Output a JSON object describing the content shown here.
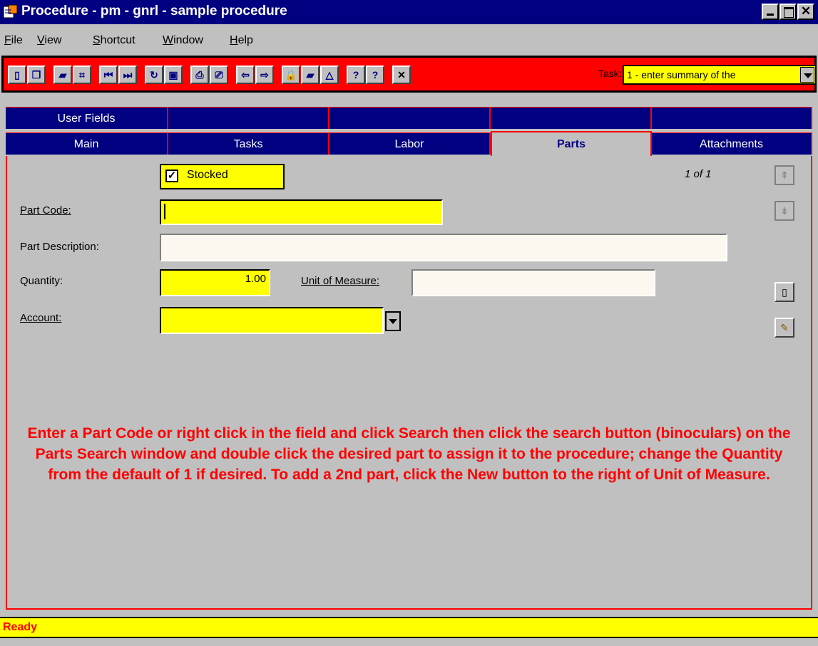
{
  "window": {
    "title": "Procedure - pm - gnrl - sample procedure",
    "minimize": "minimize",
    "maximize": "maximize",
    "close_glyph": "✕"
  },
  "menu": [
    {
      "label": "File",
      "accel": "F",
      "rest": "ile"
    },
    {
      "label": "View",
      "accel": "V",
      "rest": "iew"
    },
    {
      "label": "Shortcut",
      "accel": "S",
      "rest": "hortcut"
    },
    {
      "label": "Window",
      "accel": "W",
      "rest": "indow"
    },
    {
      "label": "Help",
      "accel": "H",
      "rest": "elp"
    }
  ],
  "toolbar": {
    "buttons": [
      {
        "name": "new-icon",
        "glyph": "▯"
      },
      {
        "name": "copy-icon",
        "glyph": "❐"
      },
      {
        "name": "open-folder-icon",
        "glyph": "▰"
      },
      {
        "name": "structure-icon",
        "glyph": "⌗"
      },
      {
        "name": "first-record-icon",
        "glyph": "⏮"
      },
      {
        "name": "last-record-icon",
        "glyph": "⏭"
      },
      {
        "name": "refresh-icon",
        "glyph": "↻"
      },
      {
        "name": "save-icon",
        "glyph": "▣"
      },
      {
        "name": "print-icon",
        "glyph": "⎙"
      },
      {
        "name": "print-preview-icon",
        "glyph": "⎚"
      },
      {
        "name": "back-icon",
        "glyph": "⇦"
      },
      {
        "name": "forward-icon",
        "glyph": "⇨"
      },
      {
        "name": "lock-icon",
        "glyph": "🔒"
      },
      {
        "name": "export-icon",
        "glyph": "▰"
      },
      {
        "name": "chart-icon",
        "glyph": "△"
      },
      {
        "name": "help-icon",
        "glyph": "?"
      },
      {
        "name": "context-help-icon",
        "glyph": "?"
      },
      {
        "name": "close-icon",
        "glyph": "✕"
      }
    ],
    "task_label": "Task:",
    "task_value": "1 - enter summary of the"
  },
  "tabs": {
    "row1": [
      "User Fields",
      "",
      "",
      "",
      ""
    ],
    "row2": [
      "Main",
      "Tasks",
      "Labor",
      "Parts",
      "Attachments"
    ],
    "active": "Parts"
  },
  "form": {
    "stocked_label": "Stocked",
    "stocked_checked": "✓",
    "record_count": "1 of 1",
    "part_code_label": "Part Code:",
    "part_code_value": "",
    "part_description_label": "Part Description:",
    "part_description_value": "",
    "quantity_label": "Quantity:",
    "quantity_value": "1.00",
    "unit_of_measure_label": "Unit of Measure:",
    "unit_of_measure_value": "",
    "account_label": "Account:",
    "account_value": ""
  },
  "side_buttons": {
    "prev_glyph": "⇞",
    "next_glyph": "⇟",
    "new_glyph": "▯",
    "delete_glyph": "✎"
  },
  "instructions": "Enter a Part Code or right click in the field and click Search then click the search button (binoculars) on the Parts Search window and double click the desired part to assign it to the procedure; change the Quantity from the default of 1 if desired.  To add a 2nd part, click the New button to the right of Unit of Measure.",
  "status": "Ready",
  "colors": {
    "title_bar": "#000080",
    "toolbar": "#ff0000",
    "required_field": "#ffff00",
    "instruction_text": "#ff0000",
    "status_bar": "#ffff00"
  }
}
